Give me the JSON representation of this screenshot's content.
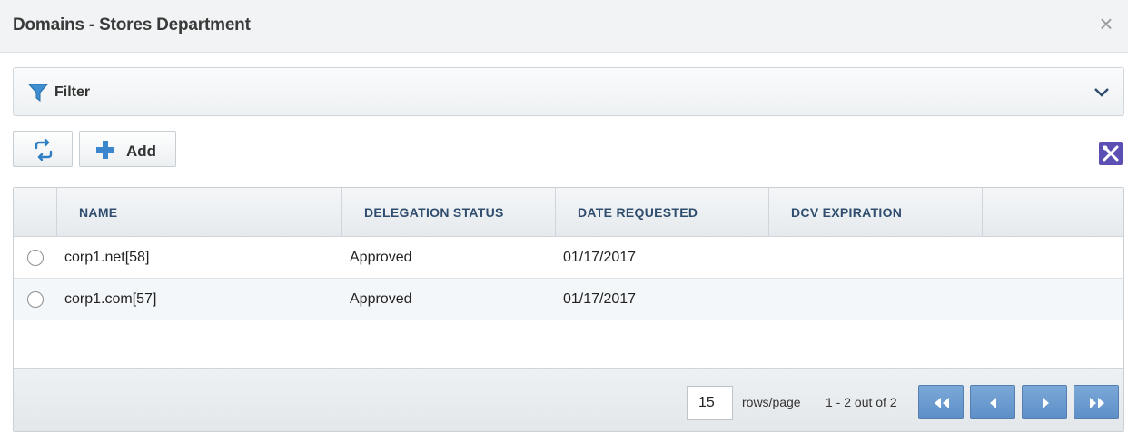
{
  "dialog": {
    "title": "Domains - Stores Department",
    "close_label": "×"
  },
  "filter": {
    "label": "Filter",
    "icons": [
      "funnel-icon",
      "chevron-down-icon"
    ]
  },
  "toolbar": {
    "refresh_icon": "refresh-icon",
    "add_label": "Add",
    "settings_icon": "tools-icon"
  },
  "table": {
    "columns": [
      "NAME",
      "DELEGATION STATUS",
      "DATE REQUESTED",
      "DCV EXPIRATION",
      ""
    ],
    "rows": [
      {
        "name": "corp1.net[58]",
        "status": "Approved",
        "date_requested": "01/17/2017",
        "dcv_expiration": ""
      },
      {
        "name": "corp1.com[57]",
        "status": "Approved",
        "date_requested": "01/17/2017",
        "dcv_expiration": ""
      }
    ]
  },
  "pagination": {
    "rows_per_page": "15",
    "rows_per_page_label": "rows/page",
    "count_text": "1 - 2 out of 2",
    "accent_color": "#6a9bd0"
  }
}
